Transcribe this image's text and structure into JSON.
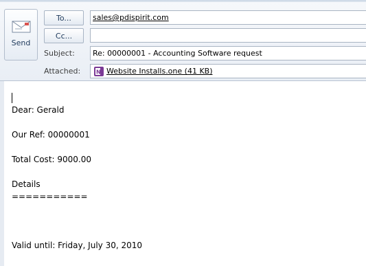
{
  "send": {
    "label": "Send"
  },
  "to": {
    "button_label": "To...",
    "value": "sales@pdispirit.com"
  },
  "cc": {
    "button_label": "Cc...",
    "value": ""
  },
  "subject": {
    "label": "Subject:",
    "value": "Re: 00000001 - Accounting Software request"
  },
  "attached": {
    "label": "Attached:",
    "file_name": "Website Installs.one (41 KB)",
    "icon": "onenote-icon"
  },
  "body": {
    "lines": [
      "Dear: Gerald",
      "Our Ref: 00000001",
      "Total Cost: 9000.00",
      "Details",
      "===========",
      "Valid until: Friday, July 30, 2010"
    ]
  },
  "colors": {
    "onenote_purple": "#7b3a96",
    "label_text": "#1e395b"
  }
}
